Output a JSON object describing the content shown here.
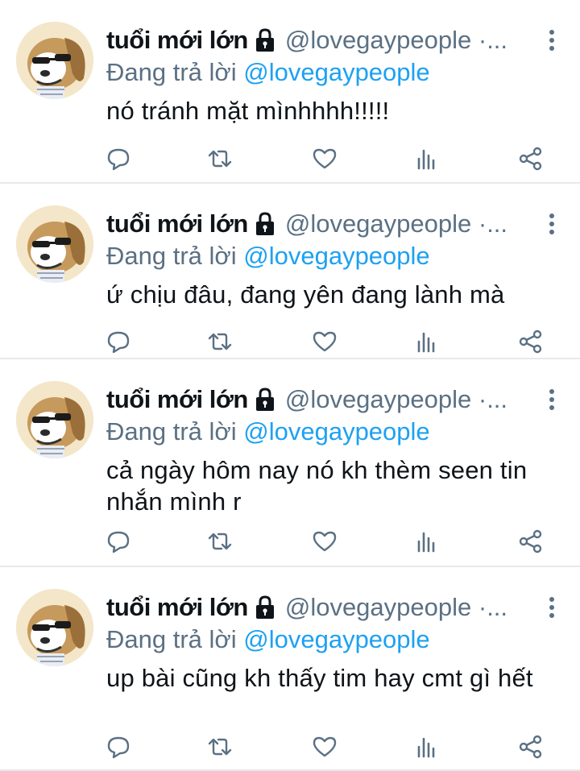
{
  "tweets": [
    {
      "name": "tuổi mới lớn",
      "handle": "@lovegaypeople ·...",
      "reply_prefix": "Đang trả lời",
      "reply_to": "@lovegaypeople",
      "text": "nó tránh mặt mìnhhhh!!!!!"
    },
    {
      "name": "tuổi mới lớn",
      "handle": "@lovegaypeople ·...",
      "reply_prefix": "Đang trả lời",
      "reply_to": "@lovegaypeople",
      "text": "ứ chịu đâu, đang yên đang lành mà"
    },
    {
      "name": "tuổi mới lớn",
      "handle": "@lovegaypeople ·...",
      "reply_prefix": "Đang trả lời",
      "reply_to": "@lovegaypeople",
      "text": "cả ngày hôm nay nó kh thèm seen tin nhắn mình r"
    },
    {
      "name": "tuổi mới lớn",
      "handle": "@lovegaypeople ·...",
      "reply_prefix": "Đang trả lời",
      "reply_to": "@lovegaypeople",
      "text": "up bài cũng kh thấy tim hay cmt gì hết"
    }
  ],
  "icons": {
    "lock": "lock-icon",
    "more": "more-vertical-icon",
    "reply": "reply-icon",
    "retweet": "retweet-icon",
    "like": "heart-icon",
    "views": "analytics-icon",
    "share": "share-icon"
  },
  "colors": {
    "secondary_text": "#5b7083",
    "mention": "#1da1f2",
    "divider": "#e6e9ec"
  }
}
